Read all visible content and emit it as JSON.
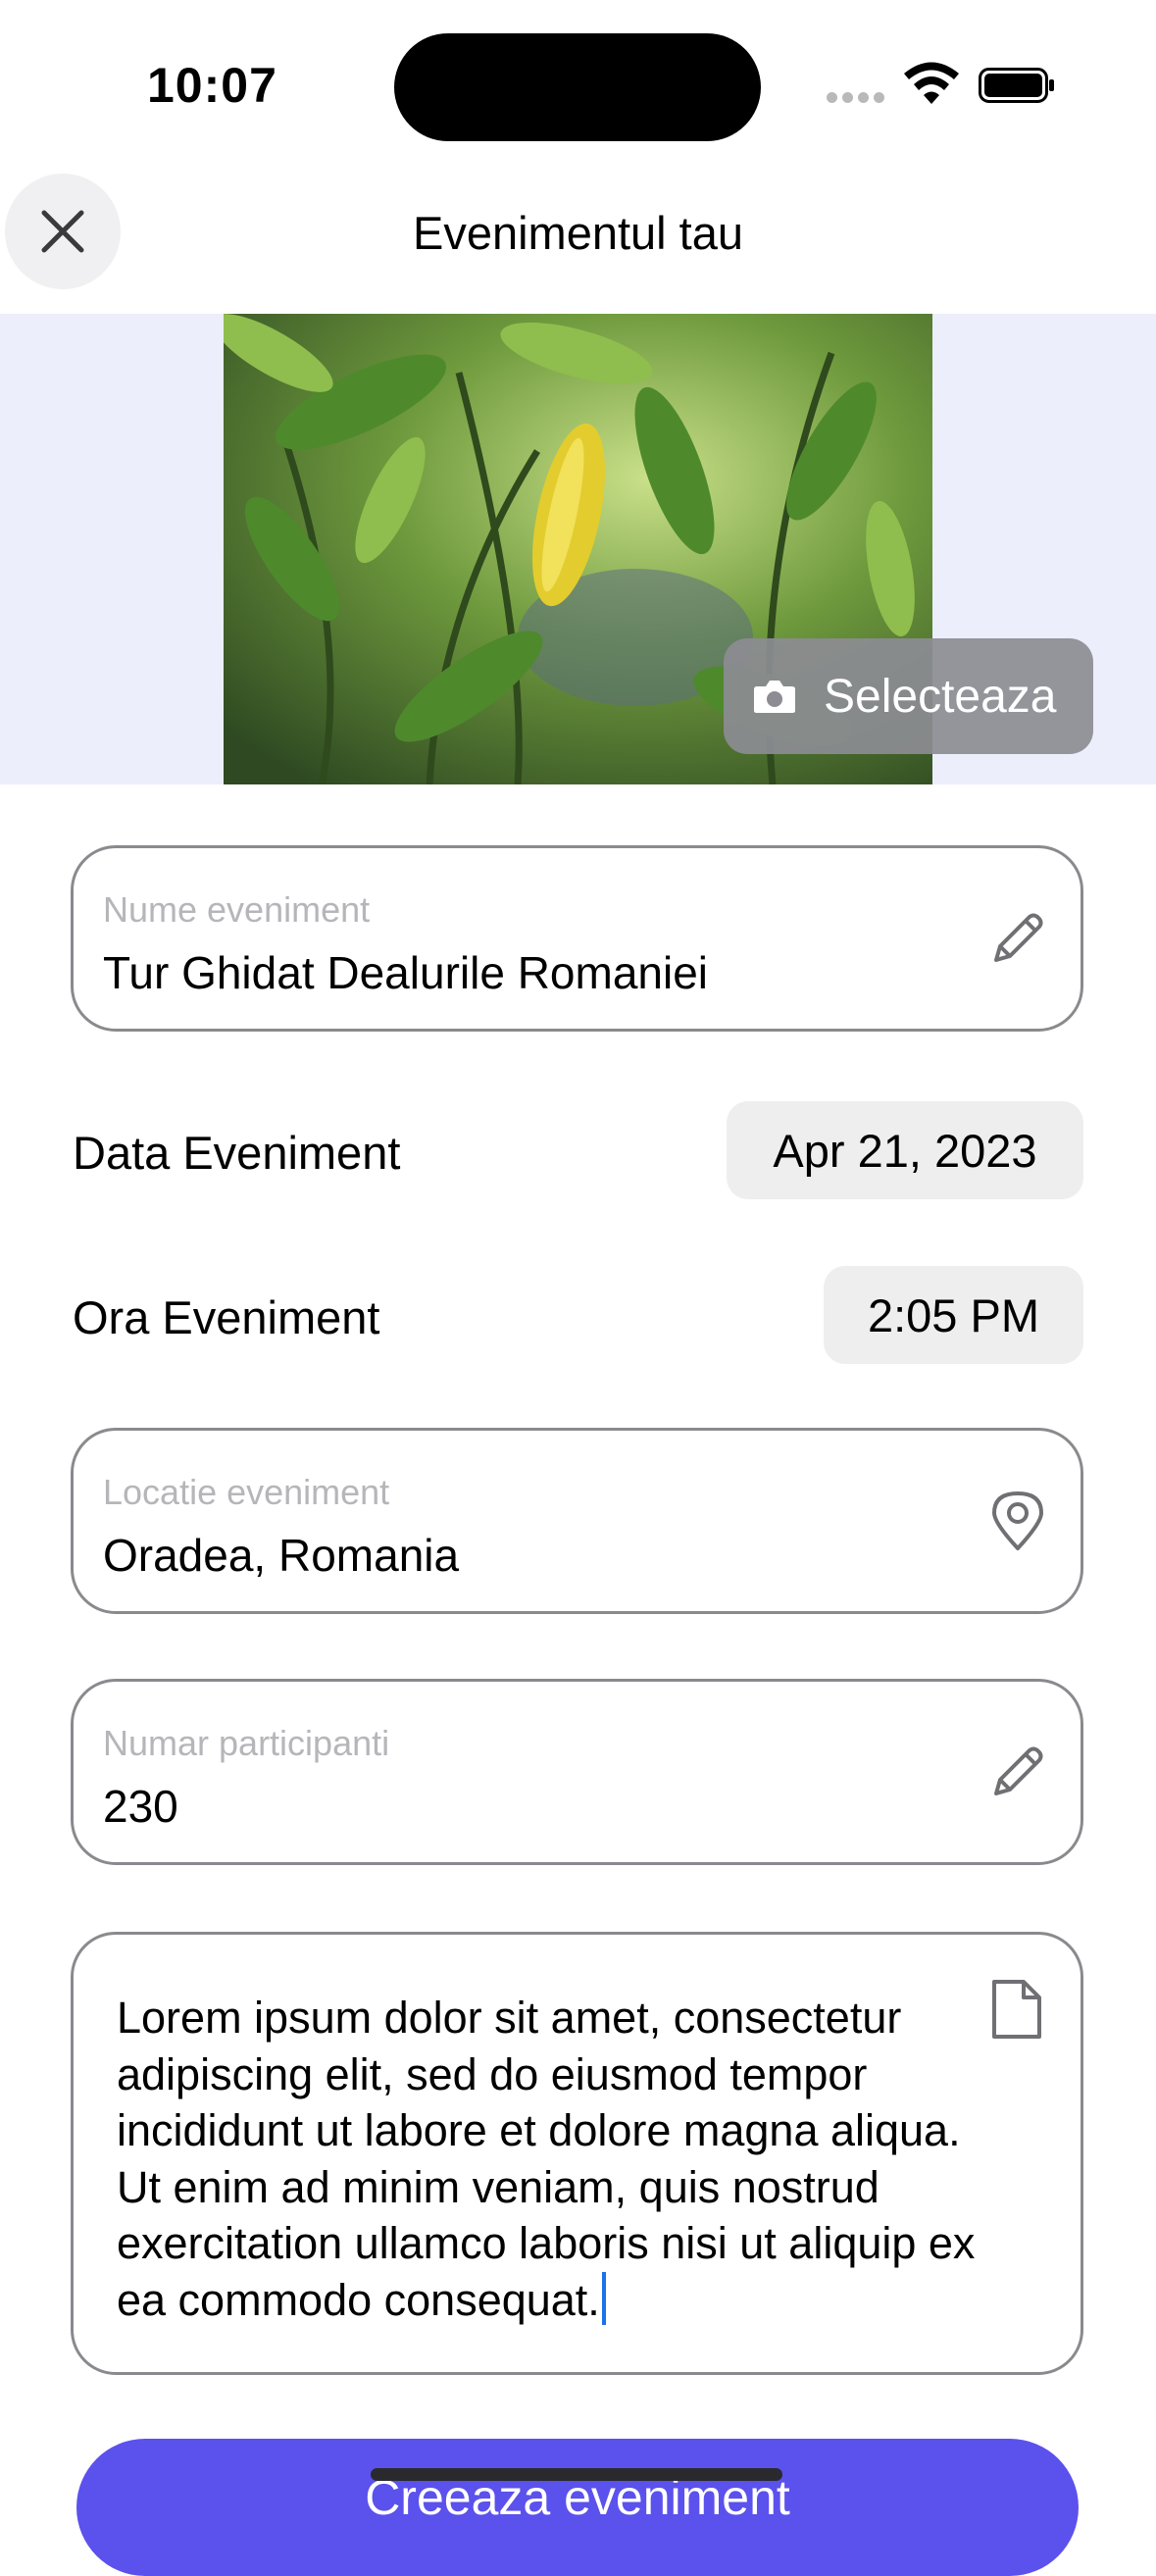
{
  "status_bar": {
    "time": "10:07"
  },
  "header": {
    "title": "Evenimentul tau",
    "close_icon": "close-icon"
  },
  "photo": {
    "button_label": "Selecteaza",
    "button_icon": "camera-icon"
  },
  "form": {
    "name": {
      "label": "Nume eveniment",
      "value": "Tur Ghidat Dealurile Romaniei",
      "icon": "pencil-icon"
    },
    "date": {
      "label": "Data Eveniment",
      "value": "Apr 21, 2023"
    },
    "time": {
      "label": "Ora Eveniment",
      "value": "2:05 PM"
    },
    "location": {
      "label": "Locatie eveniment",
      "value": "Oradea, Romania",
      "icon": "location-pin-icon"
    },
    "participants": {
      "label": "Numar participanti",
      "value": "230",
      "icon": "pencil-icon"
    },
    "description": {
      "value": "Lorem ipsum dolor sit amet, consectetur adipiscing elit, sed do eiusmod tempor incididunt ut labore et dolore magna aliqua. Ut enim ad minim veniam, quis nostrud exercitation ullamco laboris nisi ut aliquip ex ea commodo consequat.",
      "icon": "document-icon"
    }
  },
  "submit": {
    "label": "Creeaza eveniment"
  },
  "colors": {
    "accent": "#5b51ec",
    "photo_band": "#eceefb",
    "caret": "#1a73e8"
  }
}
